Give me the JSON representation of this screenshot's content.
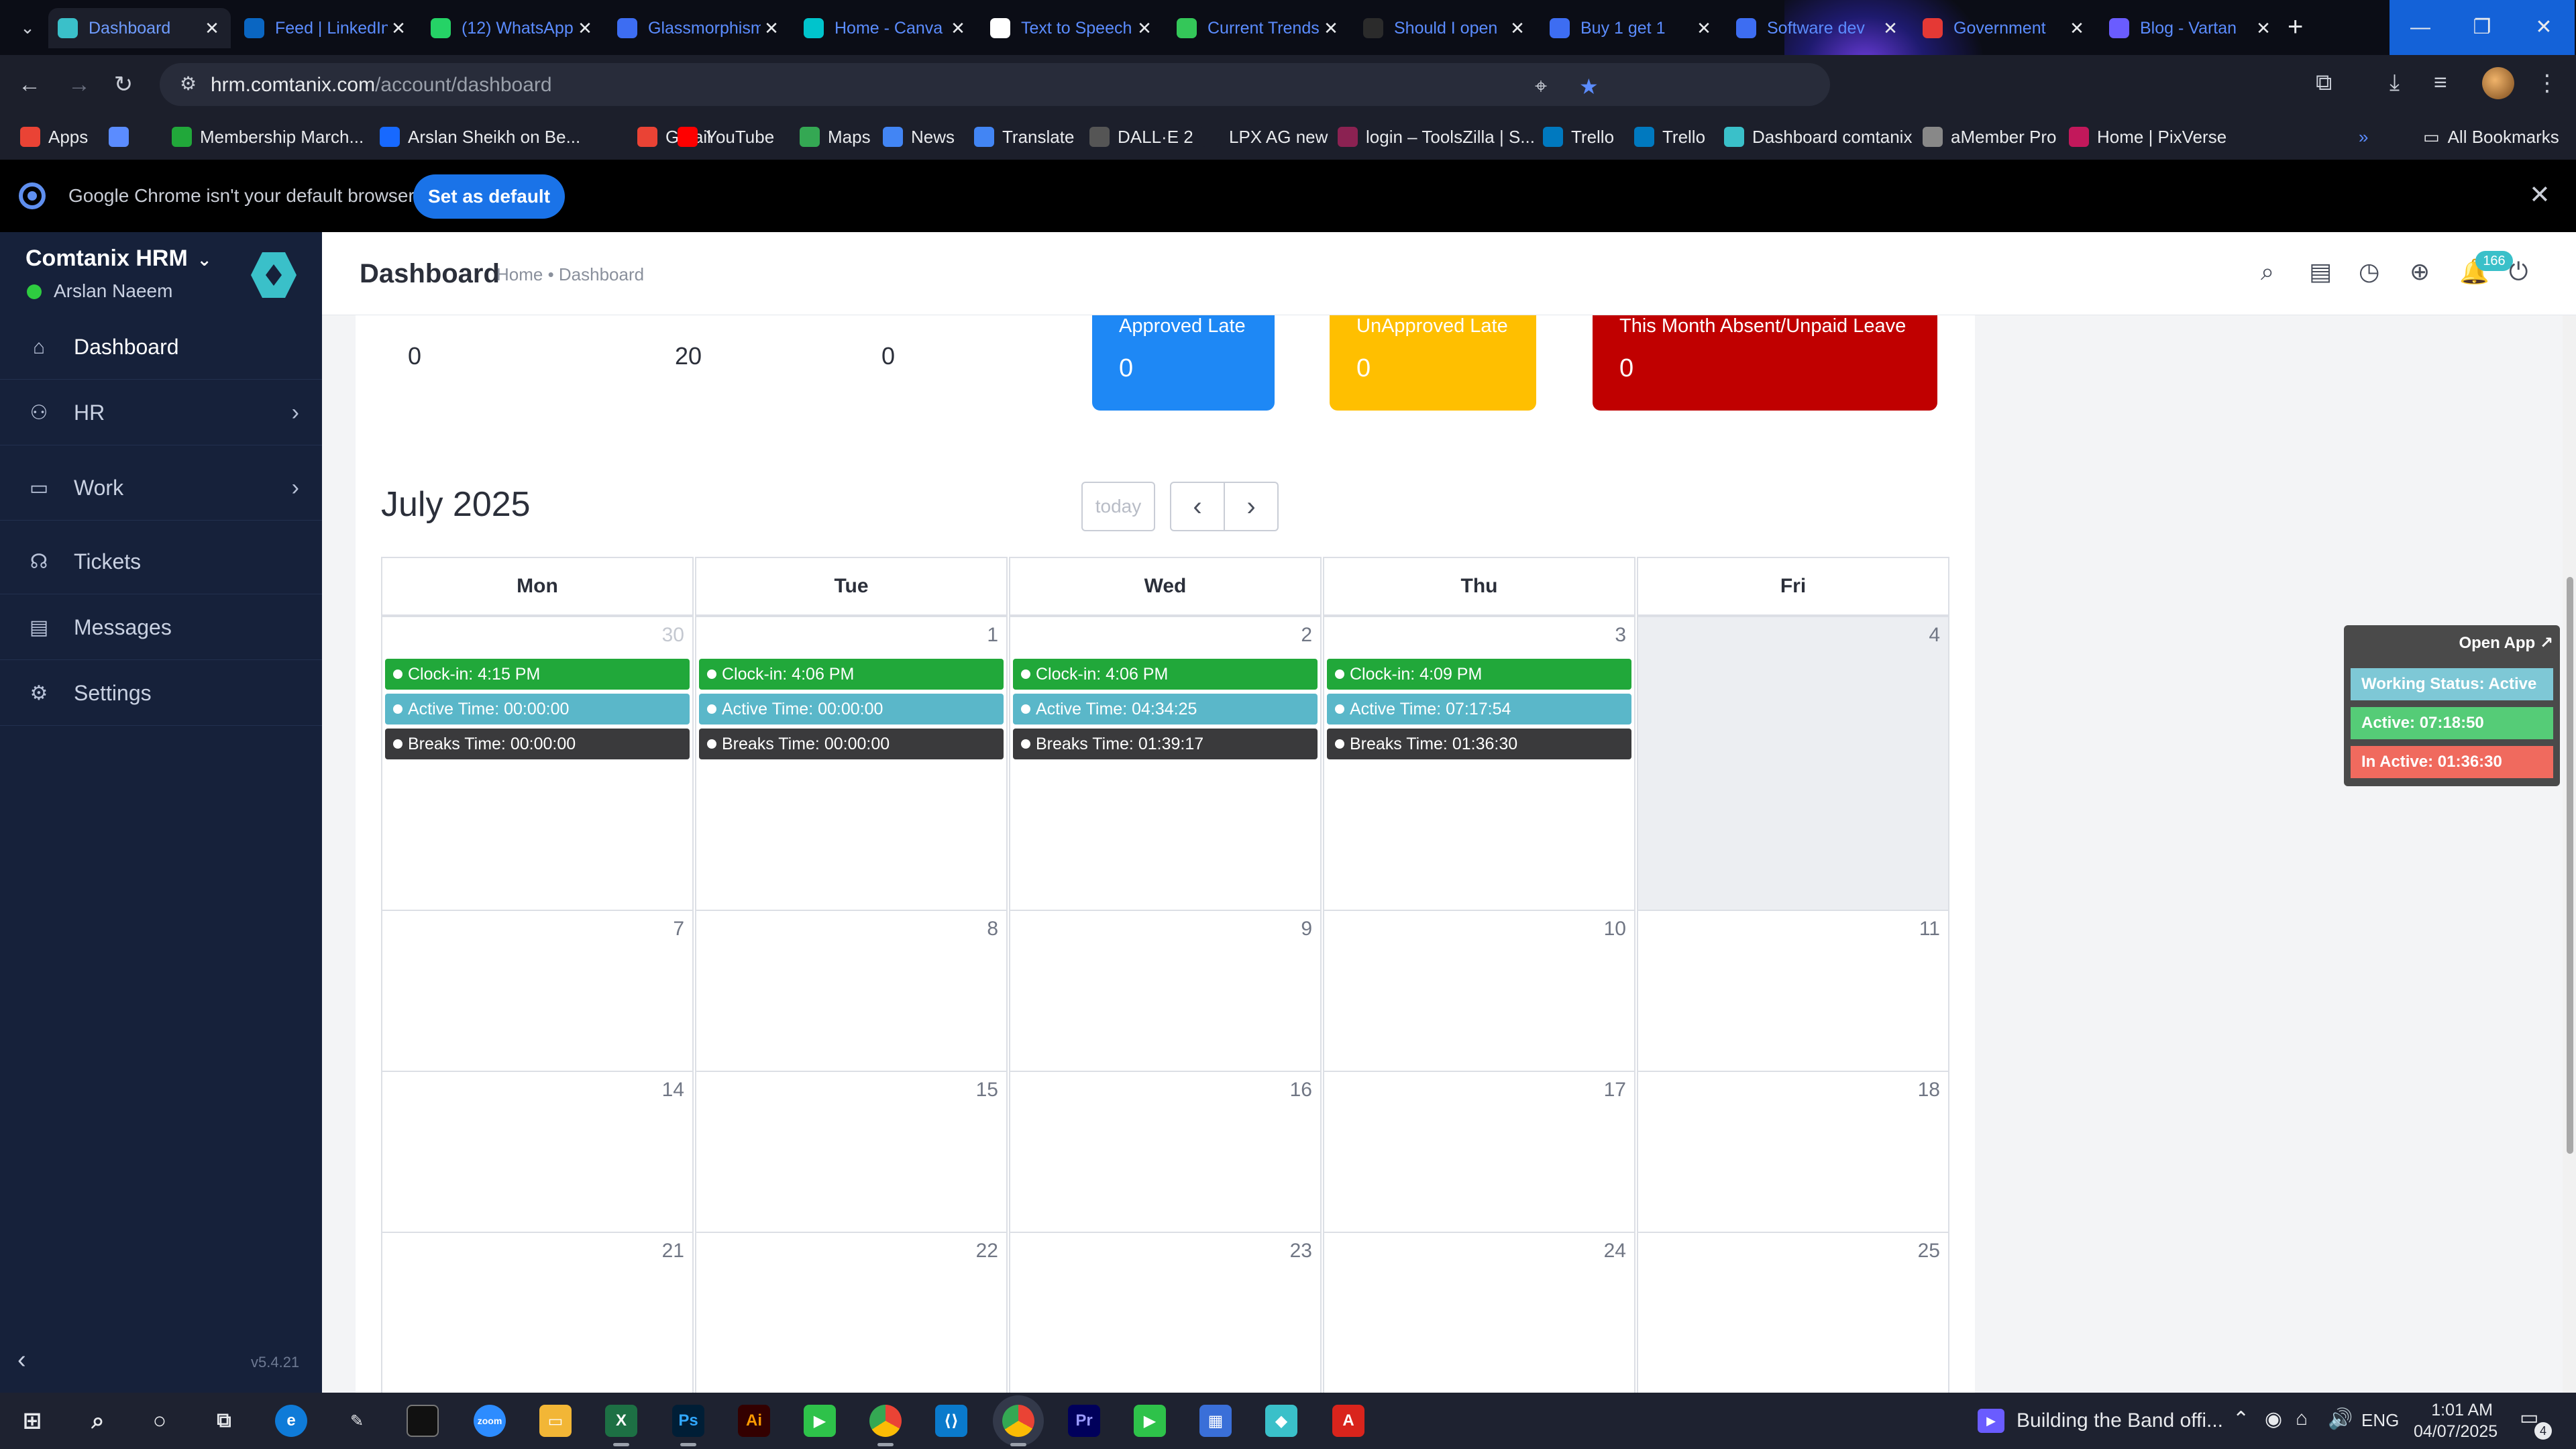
{
  "browser": {
    "tabs": [
      {
        "title": "Dashboard",
        "icon": "comtanix-icon",
        "color": "#3ac0c9",
        "active": true
      },
      {
        "title": "Feed | LinkedIn",
        "icon": "linkedin-icon",
        "color": "#0a66c2"
      },
      {
        "title": "(12) WhatsApp",
        "icon": "whatsapp-icon",
        "color": "#25d366"
      },
      {
        "title": "Glassmorphism",
        "icon": "doc-icon",
        "color": "#3d6df2"
      },
      {
        "title": "Home - Canva",
        "icon": "canva-icon",
        "color": "#00c4cc"
      },
      {
        "title": "Text to Speech",
        "icon": "speech-icon",
        "color": "#ffffff"
      },
      {
        "title": "Current Trends",
        "icon": "trends-icon",
        "color": "#34c759"
      },
      {
        "title": "Should I open",
        "icon": "openai-icon",
        "color": "#2b2b2b"
      },
      {
        "title": "Buy 1 get 1",
        "icon": "doc-icon",
        "color": "#3d6df2"
      },
      {
        "title": "Software dev",
        "icon": "doc-icon",
        "color": "#3d6df2"
      },
      {
        "title": "Government",
        "icon": "gov-icon",
        "color": "#e53935"
      },
      {
        "title": "Blog - Vartan",
        "icon": "x-icon",
        "color": "#6a5cff"
      }
    ],
    "url_domain": "hrm.comtanix.com",
    "url_path": "/account/dashboard",
    "bookmarks": [
      {
        "label": "Apps",
        "icon": "apps-grid-icon",
        "color": "#ea4335"
      },
      {
        "label": "",
        "icon": "grid-icon",
        "color": "#5b8cff"
      },
      {
        "label": "Membership March...",
        "icon": "plus-icon",
        "color": "#21a83a"
      },
      {
        "label": "Arslan Sheikh on Be...",
        "icon": "behance-icon",
        "color": "#1769ff"
      },
      {
        "label": "Gmail",
        "icon": "gmail-icon",
        "color": "#ea4335"
      },
      {
        "label": "YouTube",
        "icon": "youtube-icon",
        "color": "#ff0000"
      },
      {
        "label": "Maps",
        "icon": "maps-icon",
        "color": "#34a853"
      },
      {
        "label": "News",
        "icon": "news-icon",
        "color": "#4285f4"
      },
      {
        "label": "Translate",
        "icon": "translate-icon",
        "color": "#4285f4"
      },
      {
        "label": "DALL·E 2",
        "icon": "openai-icon",
        "color": "#555555"
      },
      {
        "label": "LPX AG new",
        "icon": "blank-icon",
        "color": "#1c1f2b"
      },
      {
        "label": "login – ToolsZilla | S...",
        "icon": "toolszilla-icon",
        "color": "#8b2252"
      },
      {
        "label": "Trello",
        "icon": "trello-icon",
        "color": "#0079bf"
      },
      {
        "label": "Trello",
        "icon": "trello-icon",
        "color": "#0079bf"
      },
      {
        "label": "Dashboard comtanix",
        "icon": "comtanix-icon",
        "color": "#3ac0c9"
      },
      {
        "label": "aMember Pro",
        "icon": "amember-icon",
        "color": "#888888"
      },
      {
        "label": "Home | PixVerse",
        "icon": "pixverse-icon",
        "color": "#c2185b"
      }
    ],
    "all_bookmarks": "All Bookmarks",
    "default_banner": {
      "message": "Google Chrome isn't your default browser",
      "button": "Set as default"
    }
  },
  "sidebar": {
    "brand": "Comtanix HRM",
    "user": "Arslan Naeem",
    "items": [
      {
        "label": "Dashboard",
        "icon": "home-icon",
        "has_arrow": false
      },
      {
        "label": "HR",
        "icon": "users-icon",
        "has_arrow": true
      },
      {
        "label": "Work",
        "icon": "briefcase-icon",
        "has_arrow": true
      },
      {
        "label": "Tickets",
        "icon": "headset-icon",
        "has_arrow": false
      },
      {
        "label": "Messages",
        "icon": "chat-icon",
        "has_arrow": false
      },
      {
        "label": "Settings",
        "icon": "gear-icon",
        "has_arrow": false
      }
    ],
    "version": "v5.4.21"
  },
  "header": {
    "title": "Dashboard",
    "breadcrumb": "Home • Dashboard",
    "notifications": "166"
  },
  "stats": {
    "numbers": [
      "0",
      "20",
      "0"
    ],
    "cards": [
      {
        "label": "Approved Late",
        "value": "0",
        "color": "#1e88f5"
      },
      {
        "label": "UnApproved Late",
        "value": "0",
        "color": "#ffbf00"
      },
      {
        "label": "This Month Absent/Unpaid Leave",
        "value": "0",
        "color": "#c00000"
      }
    ]
  },
  "calendar": {
    "month": "July 2025",
    "today_label": "today",
    "weekdays": [
      "Mon",
      "Tue",
      "Wed",
      "Thu",
      "Fri"
    ],
    "weeks": [
      [
        "30",
        "1",
        "2",
        "3",
        "4"
      ],
      [
        "7",
        "8",
        "9",
        "10",
        "11"
      ],
      [
        "14",
        "15",
        "16",
        "17",
        "18"
      ],
      [
        "21",
        "22",
        "23",
        "24",
        "25"
      ]
    ],
    "events": [
      {
        "clock_in": "Clock-in: 4:15 PM",
        "active": "Active Time: 00:00:00",
        "breaks": "Breaks Time: 00:00:00"
      },
      {
        "clock_in": "Clock-in: 4:06 PM",
        "active": "Active Time: 00:00:00",
        "breaks": "Breaks Time: 00:00:00"
      },
      {
        "clock_in": "Clock-in: 4:06 PM",
        "active": "Active Time: 04:34:25",
        "breaks": "Breaks Time: 01:39:17"
      },
      {
        "clock_in": "Clock-in: 4:09 PM",
        "active": "Active Time: 07:17:54",
        "breaks": "Breaks Time: 01:36:30"
      }
    ]
  },
  "status_widget": {
    "open_app": "Open App ↗",
    "working": "Working Status: Active",
    "active": "Active: 07:18:50",
    "inactive": "In Active: 01:36:30"
  },
  "taskbar": {
    "media": "Building the Band offi...",
    "lang": "ENG",
    "time": "1:01 AM",
    "date": "04/07/2025",
    "notif_count": "4"
  }
}
